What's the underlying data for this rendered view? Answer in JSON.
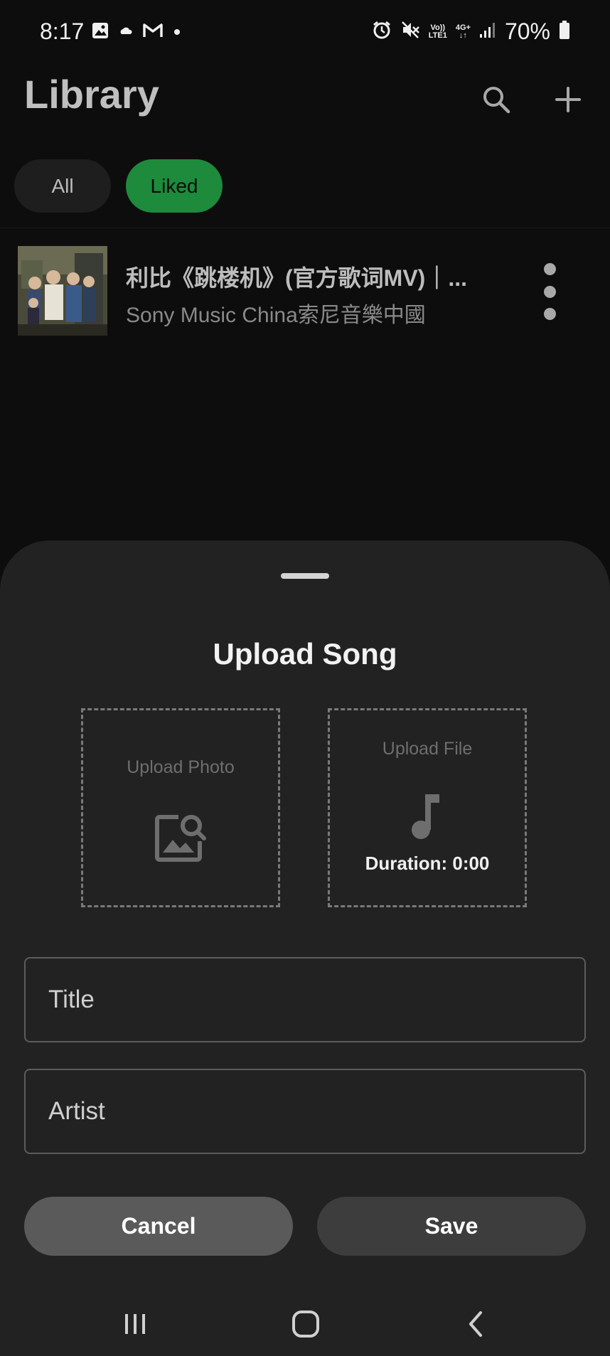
{
  "status_bar": {
    "time": "8:17",
    "battery_percent": "70%",
    "network_vo": "Vo))",
    "network_lte": "LTE1",
    "network_4g": "4G+",
    "icons": [
      "image-icon",
      "cloud-icon",
      "gmail-icon",
      "dot-icon",
      "alarm-icon",
      "mute-icon",
      "signal-icon",
      "battery-icon"
    ]
  },
  "header": {
    "title": "Library",
    "icons": [
      "search-icon",
      "plus-icon"
    ]
  },
  "filters": {
    "all_label": "All",
    "liked_label": "Liked",
    "selected": "Liked"
  },
  "songs": [
    {
      "title": "利比《跳楼机》(官方歌词MV)｜...",
      "artist": "Sony Music China索尼音樂中國"
    }
  ],
  "upload_sheet": {
    "title": "Upload Song",
    "upload_photo_label": "Upload Photo",
    "upload_file_label": "Upload File",
    "duration_text": "Duration: 0:00",
    "title_placeholder": "Title",
    "artist_placeholder": "Artist",
    "cancel_label": "Cancel",
    "save_label": "Save"
  },
  "colors": {
    "background": "#0d0d0d",
    "sheet": "#222222",
    "accent_green": "#1d8a3c"
  },
  "nav_bar": {
    "icons": [
      "recents-icon",
      "home-icon",
      "back-icon"
    ]
  }
}
